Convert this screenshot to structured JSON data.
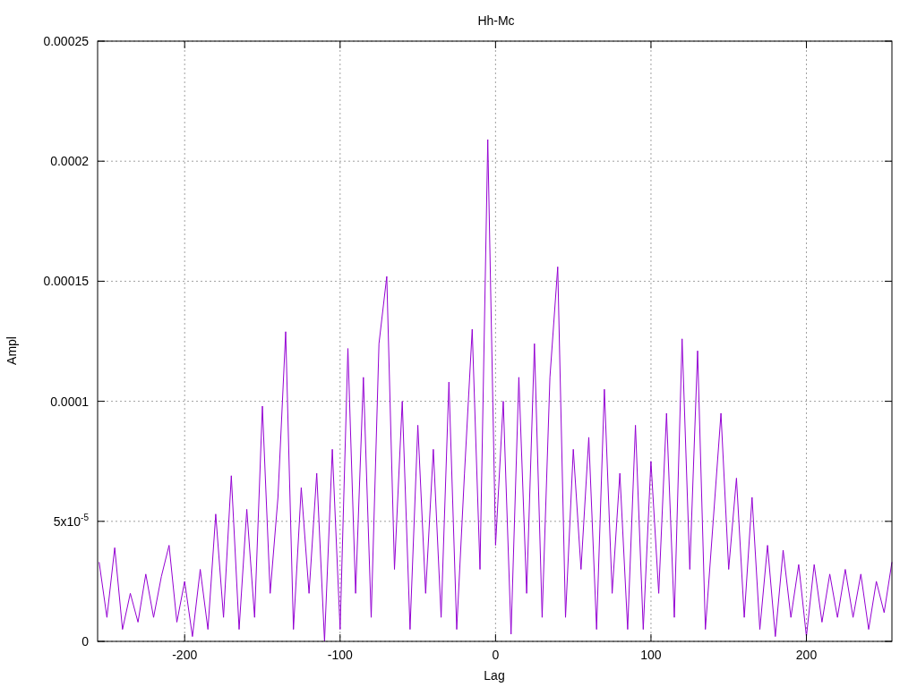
{
  "chart_data": {
    "type": "line",
    "title": "Hh-Mc",
    "xlabel": "Lag",
    "ylabel": "Ampl",
    "grid": true,
    "xlim": [
      -256,
      255
    ],
    "ylim": [
      0,
      0.00025
    ],
    "xticks": [
      -200,
      -100,
      0,
      100,
      200
    ],
    "yticks": [
      {
        "value": 0,
        "label": "0"
      },
      {
        "value": 5e-05,
        "label": "5x10$^{-5}$"
      },
      {
        "value": 0.0001,
        "label": "0.0001"
      },
      {
        "value": 0.00015,
        "label": "0.00015"
      },
      {
        "value": 0.0002,
        "label": "0.0002"
      },
      {
        "value": 0.00025,
        "label": "0.00025"
      }
    ],
    "x": [
      -255,
      -250,
      -245,
      -240,
      -235,
      -230,
      -225,
      -220,
      -215,
      -210,
      -205,
      -200,
      -195,
      -190,
      -185,
      -180,
      -175,
      -170,
      -165,
      -160,
      -155,
      -150,
      -145,
      -140,
      -135,
      -130,
      -125,
      -120,
      -115,
      -110,
      -105,
      -100,
      -95,
      -90,
      -85,
      -80,
      -75,
      -70,
      -65,
      -60,
      -55,
      -50,
      -45,
      -40,
      -35,
      -30,
      -25,
      -20,
      -15,
      -10,
      -5,
      0,
      5,
      10,
      15,
      20,
      25,
      30,
      35,
      40,
      45,
      50,
      55,
      60,
      65,
      70,
      75,
      80,
      85,
      90,
      95,
      100,
      105,
      110,
      115,
      120,
      125,
      130,
      135,
      140,
      145,
      150,
      155,
      160,
      165,
      170,
      175,
      180,
      185,
      190,
      195,
      200,
      205,
      210,
      215,
      220,
      225,
      230,
      235,
      240,
      245,
      250,
      255
    ],
    "series": [
      {
        "color": "#9400d3",
        "values": [
          3.3e-05,
          1e-05,
          3.9e-05,
          5e-06,
          2e-05,
          8e-06,
          2.8e-05,
          1e-05,
          2.7e-05,
          4e-05,
          8e-06,
          2.5e-05,
          2e-06,
          3e-05,
          5e-06,
          5.3e-05,
          1e-05,
          6.9e-05,
          5e-06,
          5.5e-05,
          1e-05,
          9.8e-05,
          2e-05,
          6e-05,
          0.000129,
          5e-06,
          6.4e-05,
          2e-05,
          7e-05,
          0,
          8e-05,
          5e-06,
          0.000122,
          2e-05,
          0.00011,
          1e-05,
          0.000124,
          0.000152,
          3e-05,
          0.0001,
          5e-06,
          9e-05,
          2e-05,
          8e-05,
          1e-05,
          0.000108,
          5e-06,
          7e-05,
          0.00013,
          3e-05,
          0.000209,
          4e-05,
          0.0001,
          3e-06,
          0.00011,
          2e-05,
          0.000124,
          1e-05,
          0.00011,
          0.000156,
          1e-05,
          8e-05,
          3e-05,
          8.5e-05,
          5e-06,
          0.000105,
          2e-05,
          7e-05,
          5e-06,
          9e-05,
          5e-06,
          7.5e-05,
          2e-05,
          9.5e-05,
          1e-05,
          0.000126,
          3e-05,
          0.000121,
          5e-06,
          5e-05,
          9.5e-05,
          3e-05,
          6.8e-05,
          1e-05,
          6e-05,
          5e-06,
          4e-05,
          2e-06,
          3.8e-05,
          1e-05,
          3.2e-05,
          2e-06,
          3.2e-05,
          8e-06,
          2.8e-05,
          1e-05,
          3e-05,
          1e-05,
          2.8e-05,
          5e-06,
          2.5e-05,
          1.2e-05,
          3.3e-05
        ]
      }
    ]
  }
}
